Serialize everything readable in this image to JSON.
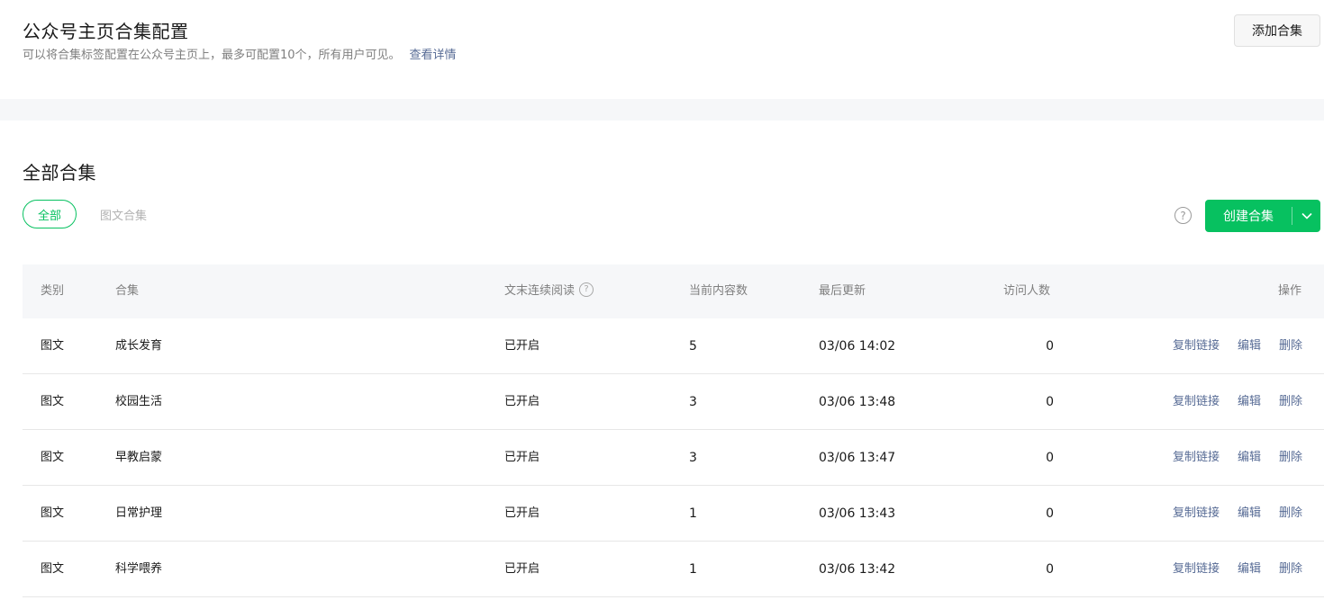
{
  "header": {
    "title": "公众号主页合集配置",
    "subtitle": "可以将合集标签配置在公众号主页上，最多可配置10个，所有用户可见。",
    "details_link": "查看详情",
    "add_button": "添加合集"
  },
  "section": {
    "title": "全部合集",
    "filters": [
      "全部",
      "图文合集"
    ],
    "active_filter": "全部",
    "help_icon": "question-circle-icon",
    "create_button": "创建合集",
    "create_dropdown_icon": "chevron-down-icon"
  },
  "table": {
    "columns": [
      "类别",
      "合集",
      "文末连续阅读",
      "当前内容数",
      "最后更新",
      "访问人数",
      "操作"
    ],
    "rows": [
      {
        "type": "图文",
        "name": "成长发育",
        "continuous_read": "已开启",
        "count": "5",
        "updated": "03/06 14:02",
        "visitors": "0"
      },
      {
        "type": "图文",
        "name": "校园生活",
        "continuous_read": "已开启",
        "count": "3",
        "updated": "03/06 13:48",
        "visitors": "0"
      },
      {
        "type": "图文",
        "name": "早教启蒙",
        "continuous_read": "已开启",
        "count": "3",
        "updated": "03/06 13:47",
        "visitors": "0"
      },
      {
        "type": "图文",
        "name": "日常护理",
        "continuous_read": "已开启",
        "count": "1",
        "updated": "03/06 13:43",
        "visitors": "0"
      },
      {
        "type": "图文",
        "name": "科学喂养",
        "continuous_read": "已开启",
        "count": "1",
        "updated": "03/06 13:42",
        "visitors": "0"
      }
    ],
    "actions": [
      "复制链接",
      "编辑",
      "删除"
    ]
  },
  "colors": {
    "accent_green": "#07c160",
    "link_blue": "#576b95",
    "header_bg": "#f6f7f9",
    "muted_text": "#7f7f7f"
  }
}
